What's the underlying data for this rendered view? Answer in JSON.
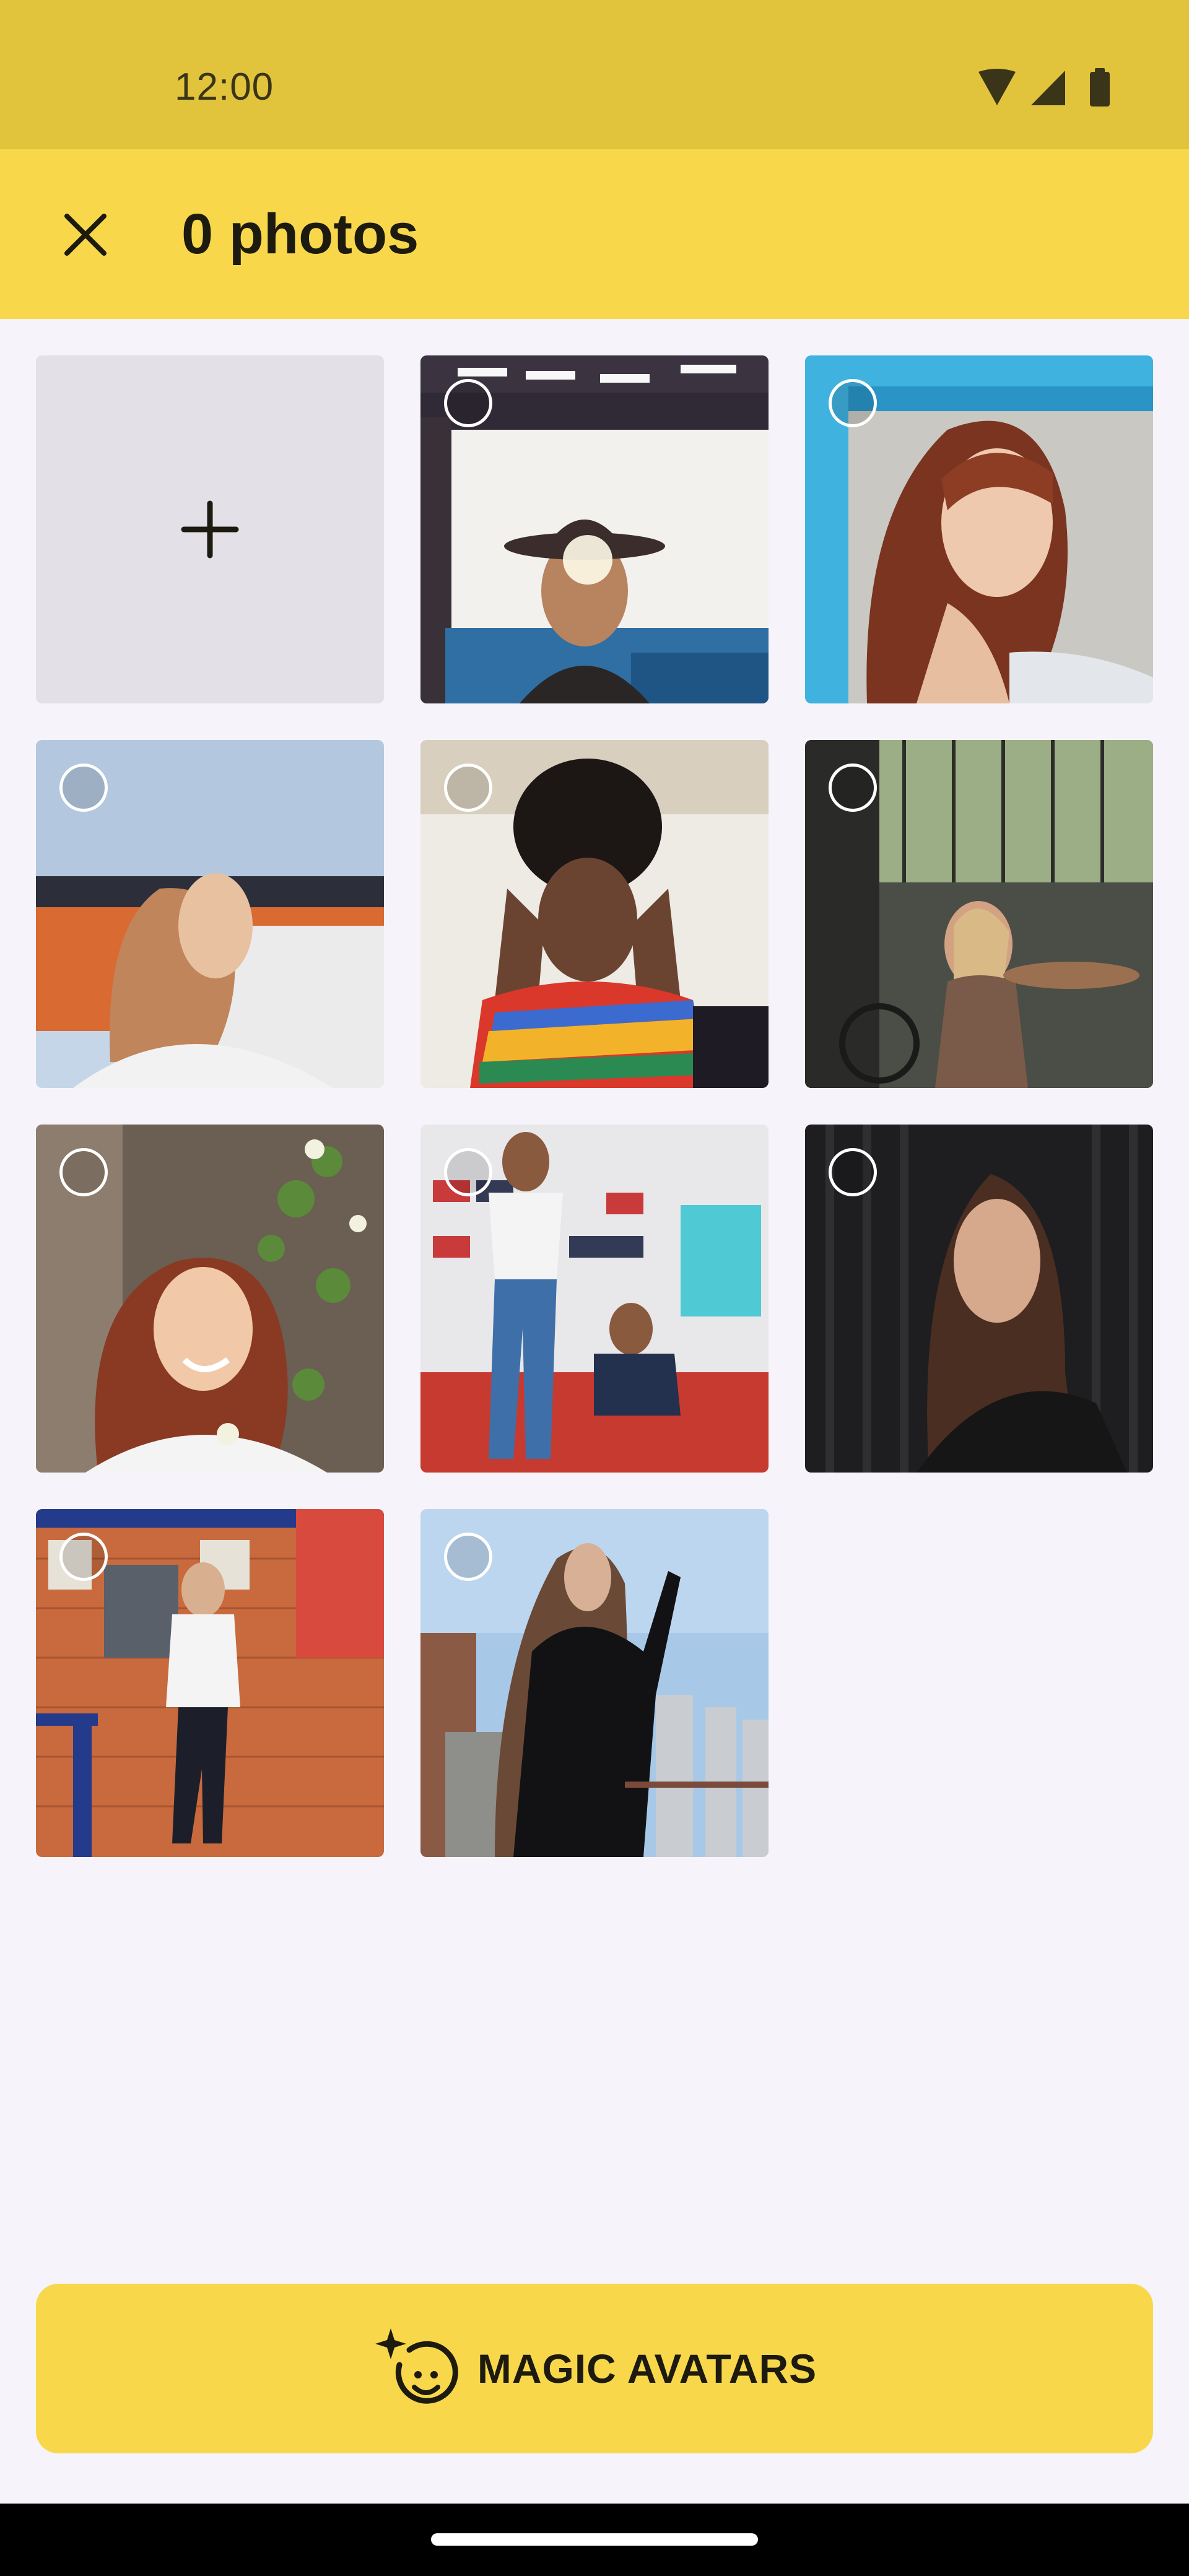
{
  "status_bar": {
    "time": "12:00",
    "icons": [
      "wifi-icon",
      "cellular-signal-icon",
      "battery-icon"
    ]
  },
  "app_bar": {
    "close_icon": "close-icon",
    "title": "0 photos"
  },
  "grid": {
    "add_icon": "plus-icon",
    "photos": [
      {
        "name": "photo-1",
        "description": "person in hat under pergola, sun flare",
        "selected": false
      },
      {
        "name": "photo-2",
        "description": "woman with auburn hair by blue window",
        "selected": false
      },
      {
        "name": "photo-3",
        "description": "person looking up, orange wall",
        "selected": false
      },
      {
        "name": "photo-4",
        "description": "woman with glasses, colorful striped shirt",
        "selected": false
      },
      {
        "name": "photo-5",
        "description": "woman at cafe table with bicycle",
        "selected": false
      },
      {
        "name": "photo-6",
        "description": "smiling woman with flowers",
        "selected": false
      },
      {
        "name": "photo-7",
        "description": "two men on red couch with sneaker shelves",
        "selected": false
      },
      {
        "name": "photo-8",
        "description": "woman in black sweater, dark curtain",
        "selected": false
      },
      {
        "name": "photo-9",
        "description": "woman leaning on brick wall",
        "selected": false
      },
      {
        "name": "photo-10",
        "description": "woman in black dress outdoors",
        "selected": false
      }
    ]
  },
  "magic_button": {
    "icon": "magic-avatar-icon",
    "label": "MAGIC AVATARS"
  },
  "colors": {
    "status_bar": "#e1c43c",
    "app_bar": "#f8d84a",
    "background": "#f6f4fa",
    "button": "#f8d84a"
  }
}
